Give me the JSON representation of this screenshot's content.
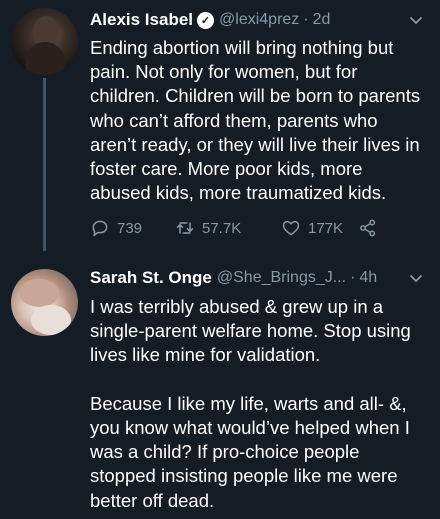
{
  "tweets": [
    {
      "name": "Alexis Isabel",
      "handle": "@lexi4prez",
      "separator": "·",
      "time": "2d",
      "text": "Ending abortion will bring nothing but\npain. Not only for women, but for\nchildren. Children will be born to parents\nwho can’t afford them, parents who\naren’t ready, or they will live their lives in\nfoster care. More poor kids, more\nabused kids, more traumatized kids.",
      "replies": "739",
      "retweets": "57.7K",
      "likes": "177K",
      "verified": true
    },
    {
      "name": "Sarah St. Onge",
      "handle": "@She_Brings_J...",
      "separator": "·",
      "time": "4h",
      "text": "I was terribly abused & grew up in a\nsingle-parent welfare home. Stop using\nlives like mine for validation.\n\nBecause I like my life, warts and all- &,\nyou know what would’ve helped when I\nwas a child? If pro-choice people\nstopped insisting people like me were\nbetter off dead."
    }
  ],
  "icons": {
    "reply": "reply-icon",
    "retweet": "retweet-icon",
    "like": "heart-icon",
    "share": "share-icon",
    "verified": "verified-badge-icon",
    "menu": "chevron-down-icon"
  },
  "colors": {
    "background": "#141d26",
    "text": "#ffffff",
    "muted": "#8899a6",
    "thread_line": "#3d5466"
  }
}
